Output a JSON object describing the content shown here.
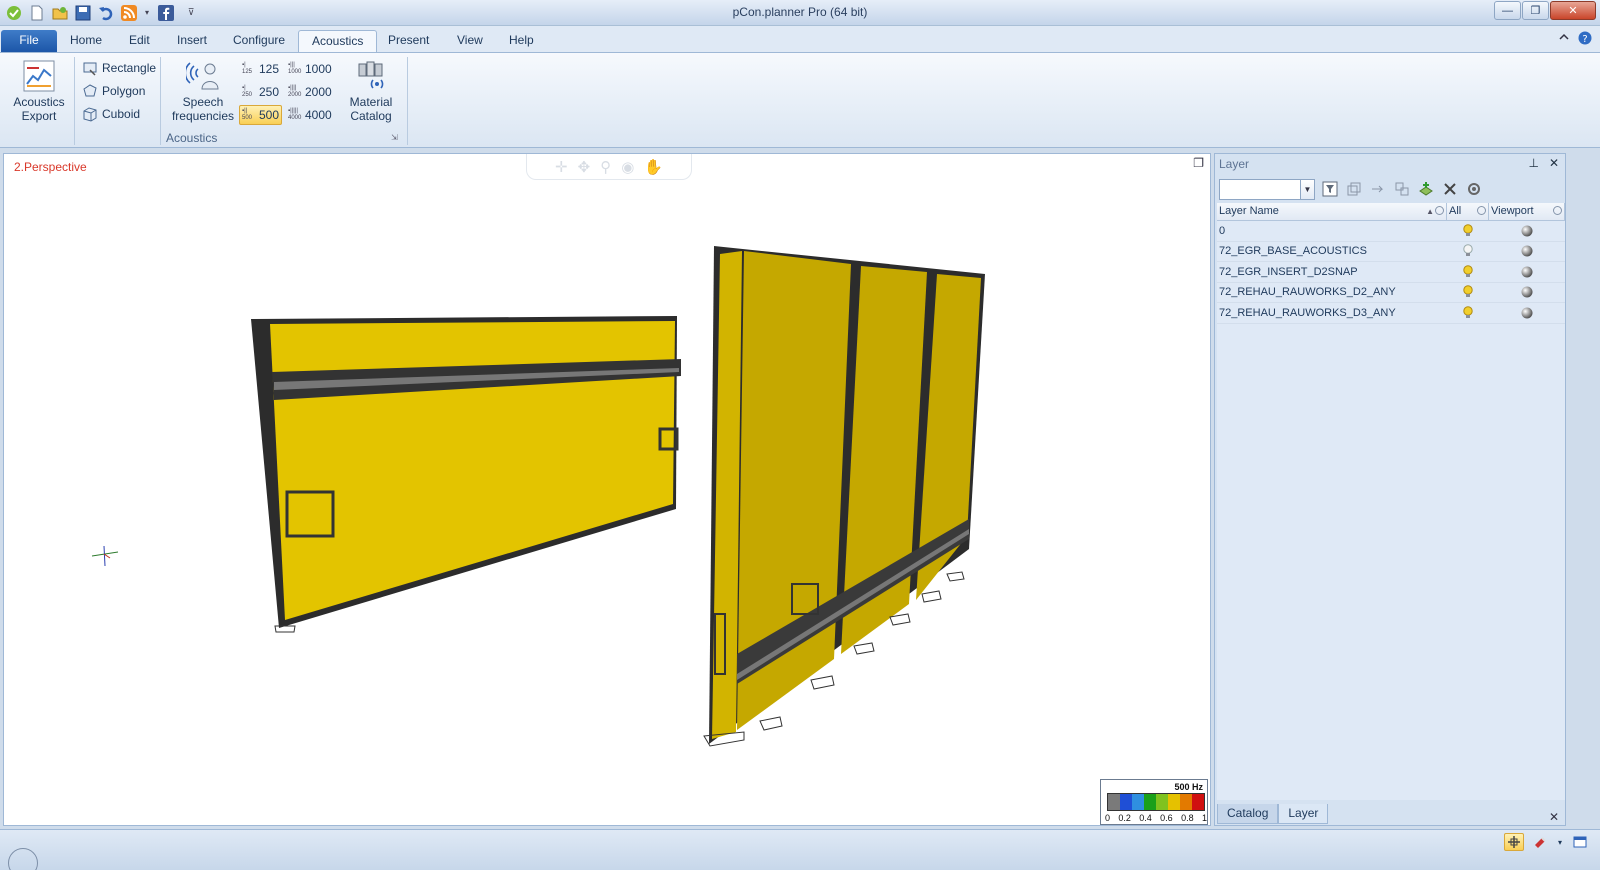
{
  "window": {
    "title": "pCon.planner Pro (64 bit)",
    "controls": {
      "minimize": "—",
      "restore": "❐",
      "close": "✕"
    }
  },
  "quick_access": [
    "check-icon",
    "new-file-icon",
    "open-folder-icon",
    "save-icon",
    "undo-icon",
    "rss-icon",
    "facebook-icon",
    "customize-icon"
  ],
  "tabs": [
    {
      "label": "File",
      "active": false
    },
    {
      "label": "Home",
      "active": false
    },
    {
      "label": "Edit",
      "active": false
    },
    {
      "label": "Insert",
      "active": false
    },
    {
      "label": "Configure",
      "active": false
    },
    {
      "label": "Acoustics",
      "active": true
    },
    {
      "label": "Present",
      "active": false
    },
    {
      "label": "View",
      "active": false
    },
    {
      "label": "Help",
      "active": false
    }
  ],
  "ribbon": {
    "acoustics_export": "Acoustics\nExport",
    "shapes": [
      "Rectangle",
      "Polygon",
      "Cuboid"
    ],
    "speech_frequencies": "Speech\nfrequencies",
    "freq_icons": [
      "125",
      "250",
      "500",
      "1000",
      "2000",
      "4000"
    ],
    "frequencies": [
      "125",
      "250",
      "500",
      "1000",
      "2000",
      "4000"
    ],
    "selected_frequency": "500",
    "material_catalog": "Material\nCatalog",
    "group_label": "Acoustics"
  },
  "viewport": {
    "label": "2.Perspective",
    "legend": {
      "title": "500 Hz",
      "ticks": [
        "0",
        "0.2",
        "0.4",
        "0.6",
        "0.8",
        "1"
      ],
      "colors": [
        "#7a7a7a",
        "#1f4fd6",
        "#2f8fe0",
        "#1aa01a",
        "#7fc21f",
        "#e5c100",
        "#e37a00",
        "#d01010"
      ]
    },
    "object_color": "#e3c400"
  },
  "layer_panel": {
    "title": "Layer",
    "filter_value": "",
    "columns": {
      "name": "Layer Name",
      "all": "All",
      "viewport": "Viewport"
    },
    "rows": [
      {
        "name": "0",
        "all": "on"
      },
      {
        "name": "72_EGR_BASE_ACOUSTICS",
        "all": "off"
      },
      {
        "name": "72_EGR_INSERT_D2SNAP",
        "all": "on"
      },
      {
        "name": "72_REHAU_RAUWORKS_D2_ANY",
        "all": "on"
      },
      {
        "name": "72_REHAU_RAUWORKS_D3_ANY",
        "all": "on"
      }
    ],
    "tabs": [
      "Catalog",
      "Layer"
    ],
    "active_tab": "Layer"
  }
}
